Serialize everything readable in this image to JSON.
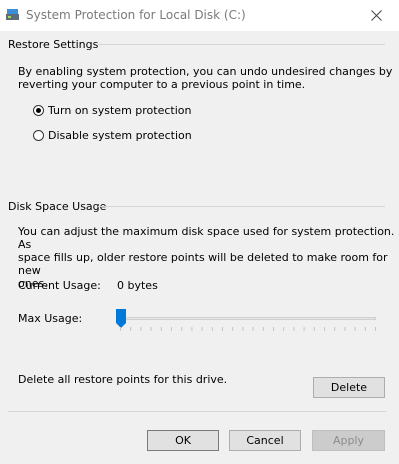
{
  "window": {
    "title": "System Protection for Local Disk (C:)",
    "close_glyph": "✕"
  },
  "restore": {
    "group_label": "Restore Settings",
    "description_line1": "By enabling system protection, you can undo undesired changes by",
    "description_line2": "reverting your computer to a previous point in time.",
    "options": [
      {
        "label": "Turn on system protection",
        "checked": true
      },
      {
        "label": "Disable system protection",
        "checked": false
      }
    ]
  },
  "disk": {
    "group_label": "Disk Space Usage",
    "description_line1": "You can adjust the maximum disk space used for system protection. As",
    "description_line2": "space fills up, older restore points will be deleted to make room for new",
    "description_line3": "ones.",
    "current_usage_label": "Current Usage:",
    "current_usage_value": "0 bytes",
    "max_usage_label": "Max Usage:",
    "max_usage_fraction": 0,
    "delete_text": "Delete all restore points for this drive.",
    "delete_button": "Delete"
  },
  "footer": {
    "ok": "OK",
    "cancel": "Cancel",
    "apply": "Apply"
  },
  "colors": {
    "accent": "#0078d7",
    "background": "#f0f0f0"
  }
}
